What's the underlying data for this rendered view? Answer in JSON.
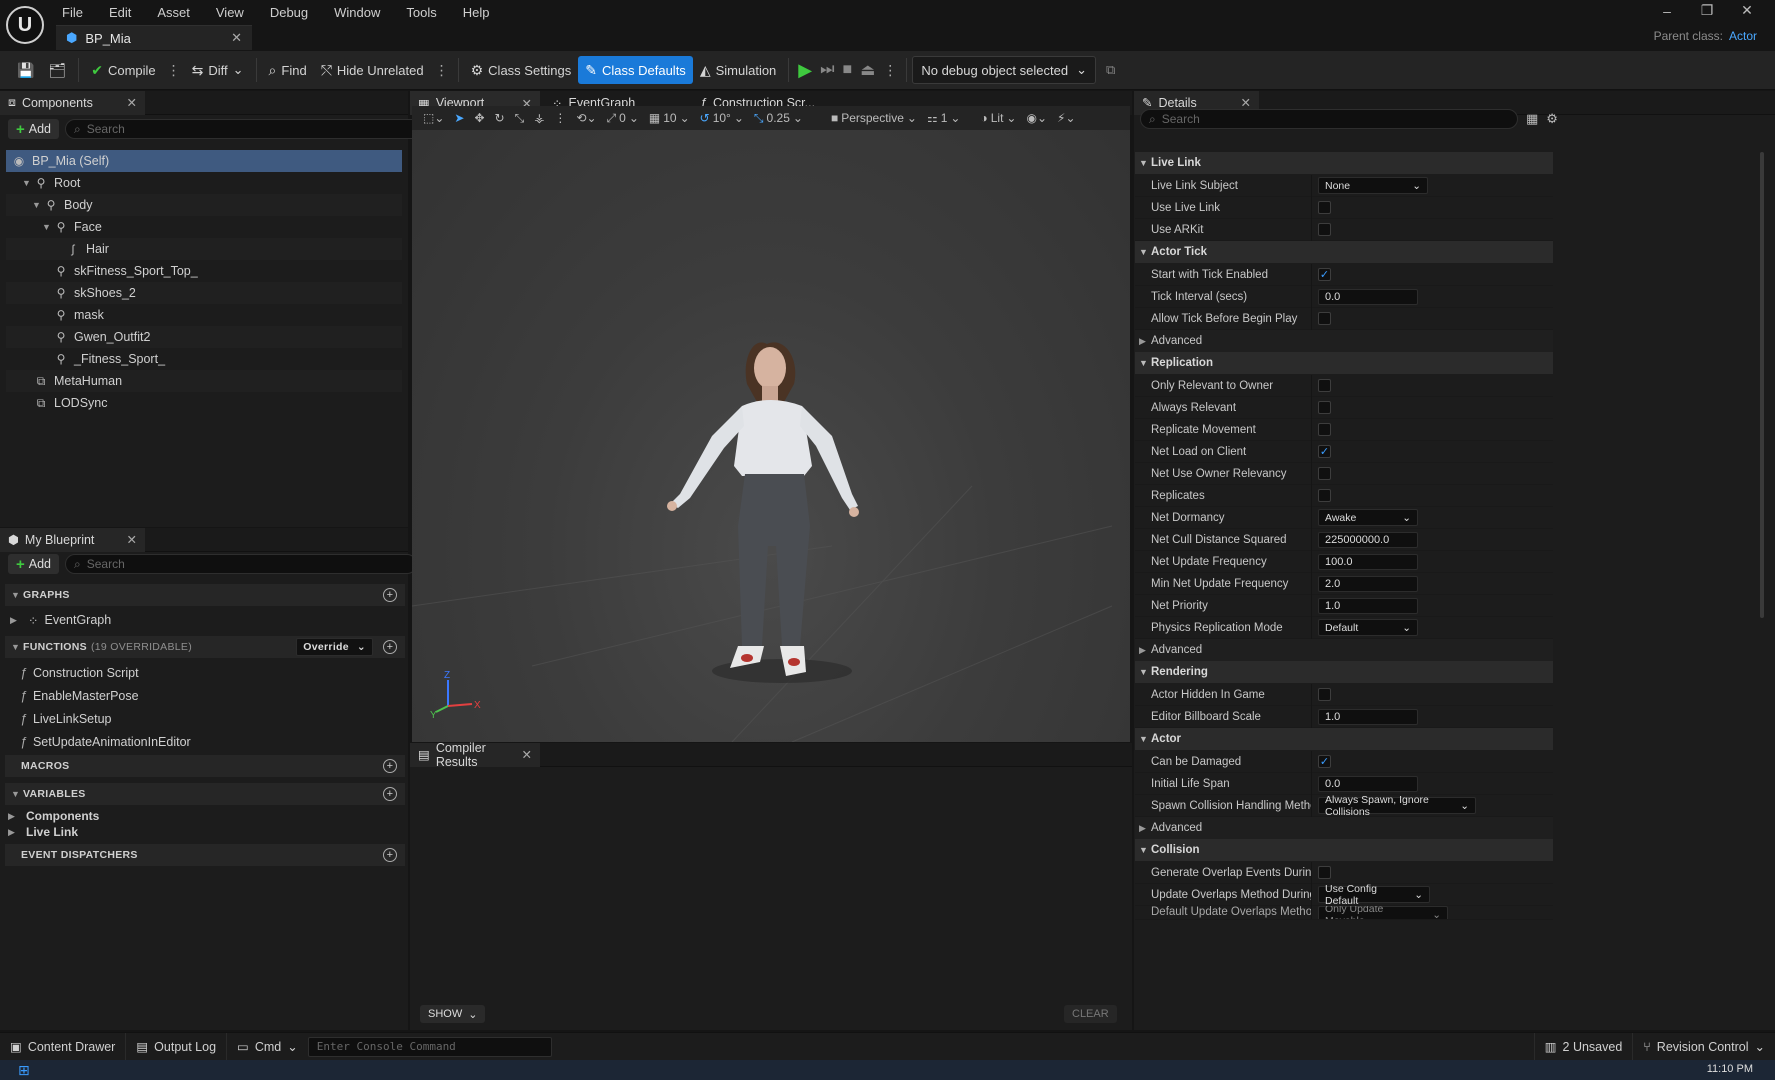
{
  "menu": [
    "File",
    "Edit",
    "Asset",
    "View",
    "Debug",
    "Window",
    "Tools",
    "Help"
  ],
  "document_tab": {
    "title": "BP_Mia"
  },
  "parent_class": {
    "label": "Parent class:",
    "value": "Actor"
  },
  "toolbar": {
    "compile": "Compile",
    "diff": "Diff",
    "find": "Find",
    "hide_unrelated": "Hide Unrelated",
    "class_settings": "Class Settings",
    "class_defaults": "Class Defaults",
    "simulation": "Simulation",
    "debug_object": "No debug object selected"
  },
  "components_panel": {
    "tab": "Components",
    "add": "Add",
    "search_placeholder": "Search",
    "items": [
      {
        "label": "BP_Mia (Self)"
      },
      {
        "label": "Root"
      },
      {
        "label": "Body"
      },
      {
        "label": "Face"
      },
      {
        "label": "Hair"
      },
      {
        "label": "skFitness_Sport_Top_"
      },
      {
        "label": "skShoes_2"
      },
      {
        "label": "mask"
      },
      {
        "label": "Gwen_Outfit2"
      },
      {
        "label": "_Fitness_Sport_"
      },
      {
        "label": "MetaHuman"
      },
      {
        "label": "LODSync"
      }
    ]
  },
  "my_blueprint": {
    "tab": "My Blueprint",
    "add": "Add",
    "search_placeholder": "Search",
    "graphs": "GRAPHS",
    "event_graph": "EventGraph",
    "functions": "FUNCTIONS",
    "functions_count": "(19 OVERRIDABLE)",
    "override": "Override",
    "function_items": [
      "Construction Script",
      "EnableMasterPose",
      "LiveLinkSetup",
      "SetUpdateAnimationInEditor"
    ],
    "macros": "MACROS",
    "variables": "VARIABLES",
    "variable_groups": [
      "Components",
      "Live Link"
    ],
    "event_dispatchers": "EVENT DISPATCHERS"
  },
  "editor_tabs": {
    "viewport": "Viewport",
    "event_graph": "EventGraph",
    "construction": "Construction Scr..."
  },
  "viewport_toolbar": {
    "rot": "0",
    "grid": "10",
    "angle": "10°",
    "scale": "0.25",
    "perspective": "Perspective",
    "cams": "1",
    "lit": "Lit"
  },
  "compiler": {
    "tab": "Compiler Results",
    "show": "SHOW",
    "clear": "CLEAR"
  },
  "details": {
    "tab": "Details",
    "search_placeholder": "Search",
    "live_link": "Live Link",
    "live_link_subject": "Live Link Subject",
    "live_link_subject_val": "None",
    "use_live_link": "Use Live Link",
    "use_arkit": "Use ARKit",
    "actor_tick": "Actor Tick",
    "start_tick": "Start with Tick Enabled",
    "tick_interval": "Tick Interval (secs)",
    "tick_interval_val": "0.0",
    "allow_tick": "Allow Tick Before Begin Play",
    "advanced": "Advanced",
    "replication": "Replication",
    "only_relevant": "Only Relevant to Owner",
    "always_relevant": "Always Relevant",
    "replicate_movement": "Replicate Movement",
    "net_load": "Net Load on Client",
    "net_owner_rel": "Net Use Owner Relevancy",
    "replicates": "Replicates",
    "net_dormancy": "Net Dormancy",
    "net_dormancy_val": "Awake",
    "net_cull": "Net Cull Distance Squared",
    "net_cull_val": "225000000.0",
    "net_update": "Net Update Frequency",
    "net_update_val": "100.0",
    "min_net_update": "Min Net Update Frequency",
    "min_net_update_val": "2.0",
    "net_priority": "Net Priority",
    "net_priority_val": "1.0",
    "physics_rep": "Physics Replication Mode",
    "physics_rep_val": "Default",
    "rendering": "Rendering",
    "actor_hidden": "Actor Hidden In Game",
    "billboard": "Editor Billboard Scale",
    "billboard_val": "1.0",
    "actor": "Actor",
    "can_damaged": "Can be Damaged",
    "life_span": "Initial Life Span",
    "life_span_val": "0.0",
    "spawn_collision": "Spawn Collision Handling Method",
    "spawn_collision_val": "Always Spawn, Ignore Collisions",
    "collision": "Collision",
    "gen_overlap": "Generate Overlap Events During L...",
    "update_overlap": "Update Overlaps Method During L...",
    "update_overlap_val": "Use Config Default",
    "default_overlap": "Default Update Overlaps Method D...",
    "default_overlap_val": "Only Update Movable"
  },
  "statusbar": {
    "content_drawer": "Content Drawer",
    "output_log": "Output Log",
    "cmd": "Cmd",
    "console_placeholder": "Enter Console Command",
    "unsaved": "2 Unsaved",
    "revision": "Revision Control",
    "clock": "11:10 PM"
  }
}
